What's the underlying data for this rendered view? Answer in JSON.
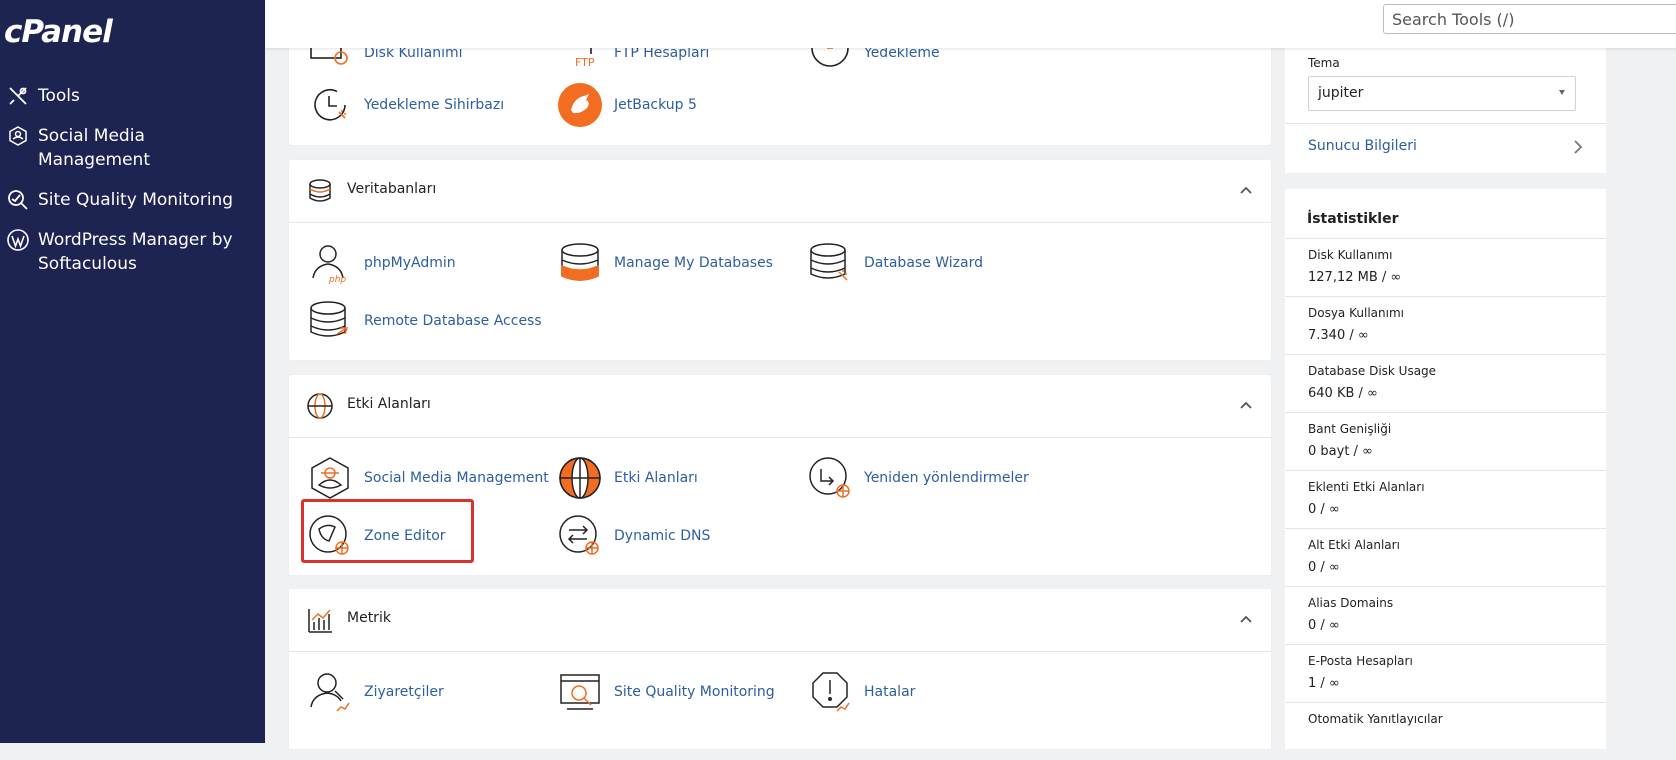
{
  "sidebar": {
    "logo": "cPanel",
    "items": [
      {
        "label": "Tools",
        "icon": "tools-icon"
      },
      {
        "label": "Social Media Management",
        "icon": "social-media-icon"
      },
      {
        "label": "Site Quality Monitoring",
        "icon": "magnifier-icon"
      },
      {
        "label": "WordPress Manager by Softaculous",
        "icon": "wordpress-icon"
      }
    ]
  },
  "header": {
    "search_placeholder": "Search Tools (/)"
  },
  "files_panel": {
    "partial_tools": [
      "Disk Kullanımı",
      "FTP Hesapları",
      "Yedekleme"
    ],
    "tools": [
      "Yedekleme Sihirbazı",
      "JetBackup 5"
    ]
  },
  "databases_panel": {
    "title": "Veritabanları",
    "tools": [
      "phpMyAdmin",
      "Manage My Databases",
      "Database Wizard",
      "Remote Database Access"
    ]
  },
  "domains_panel": {
    "title": "Etki Alanları",
    "tools": [
      "Social Media Management",
      "Etki Alanları",
      "Yeniden yönlendirmeler",
      "Zone Editor",
      "Dynamic DNS"
    ]
  },
  "metrics_panel": {
    "title": "Metrik",
    "tools": [
      "Ziyaretçiler",
      "Site Quality Monitoring",
      "Hatalar"
    ]
  },
  "general_info": {
    "theme_label": "Tema",
    "theme_value": "jupiter",
    "server_info_link": "Sunucu Bilgileri"
  },
  "stats": {
    "title": "İstatistikler",
    "items": [
      {
        "label": "Disk Kullanımı",
        "value": "127,12 MB / ∞"
      },
      {
        "label": "Dosya Kullanımı",
        "value": "7.340 / ∞"
      },
      {
        "label": "Database Disk Usage",
        "value": "640 KB / ∞"
      },
      {
        "label": "Bant Genişliği",
        "value": "0 bayt / ∞"
      },
      {
        "label": "Eklenti Etki Alanları",
        "value": "0 / ∞"
      },
      {
        "label": "Alt Etki Alanları",
        "value": "0 / ∞"
      },
      {
        "label": "Alias Domains",
        "value": "0 / ∞"
      },
      {
        "label": "E-Posta Hesapları",
        "value": "1 / ∞"
      },
      {
        "label": "Otomatik Yanıtlayıcılar",
        "value": ""
      }
    ]
  },
  "colors": {
    "sidebar": "#1e2452",
    "link": "#2c5ea0",
    "accent_orange": "#f26d21",
    "highlight": "#d9342b"
  }
}
